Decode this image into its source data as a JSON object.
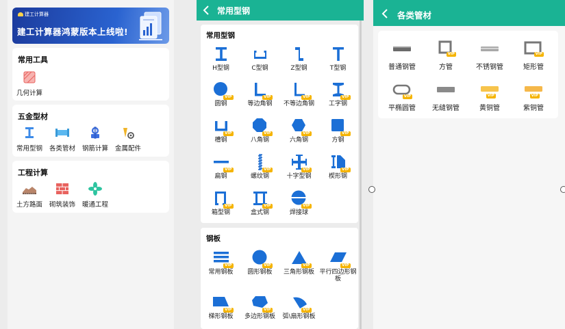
{
  "colors": {
    "teal": "#1ab394",
    "blue": "#1b6fd6",
    "vip": "#f5b400"
  },
  "home": {
    "banner": {
      "brand": "建工计算器",
      "title": "建工计算器鸿蒙版本上线啦!"
    },
    "sections": [
      {
        "title": "常用工具",
        "items": [
          {
            "label": "几何计算",
            "icon": "geometry-icon"
          }
        ]
      },
      {
        "title": "五金型材",
        "items": [
          {
            "label": "常用型钢",
            "icon": "i-beam-icon"
          },
          {
            "label": "各类管材",
            "icon": "pipe-icon"
          },
          {
            "label": "钢筋计算",
            "icon": "rebar-icon"
          },
          {
            "label": "金属配件",
            "icon": "metal-fitting-icon"
          }
        ]
      },
      {
        "title": "工程计算",
        "items": [
          {
            "label": "土方路面",
            "icon": "earthwork-icon"
          },
          {
            "label": "砌筑装饰",
            "icon": "brick-icon"
          },
          {
            "label": "暖通工程",
            "icon": "hvac-fan-icon"
          }
        ]
      }
    ]
  },
  "steel": {
    "title": "常用型钢",
    "sections": [
      {
        "title": "常用型钢",
        "items": [
          "H型钢",
          "C型钢",
          "Z型钢",
          "T型钢",
          "圆钢",
          "等边角钢",
          "不等边角钢",
          "工字钢",
          "槽钢",
          "八角钢",
          "六角钢",
          "方钢",
          "扁钢",
          "螺纹钢",
          "十字型钢",
          "楔形钢",
          "箱型钢",
          "盒式钢",
          "焊接球"
        ]
      },
      {
        "title": "钢板",
        "items": [
          "常用钢板",
          "圆形钢板",
          "三角形钢板",
          "平行四边形钢板",
          "梯形钢板",
          "多边形钢板",
          "弧\\扇形钢板"
        ]
      }
    ],
    "vip_badge": "VIP"
  },
  "pipes": {
    "title": "各类管材",
    "items": [
      "普通钢管",
      "方管",
      "不锈钢管",
      "矩形管",
      "平椭圆管",
      "无缝钢管",
      "黄铜管",
      "紫铜管"
    ]
  }
}
